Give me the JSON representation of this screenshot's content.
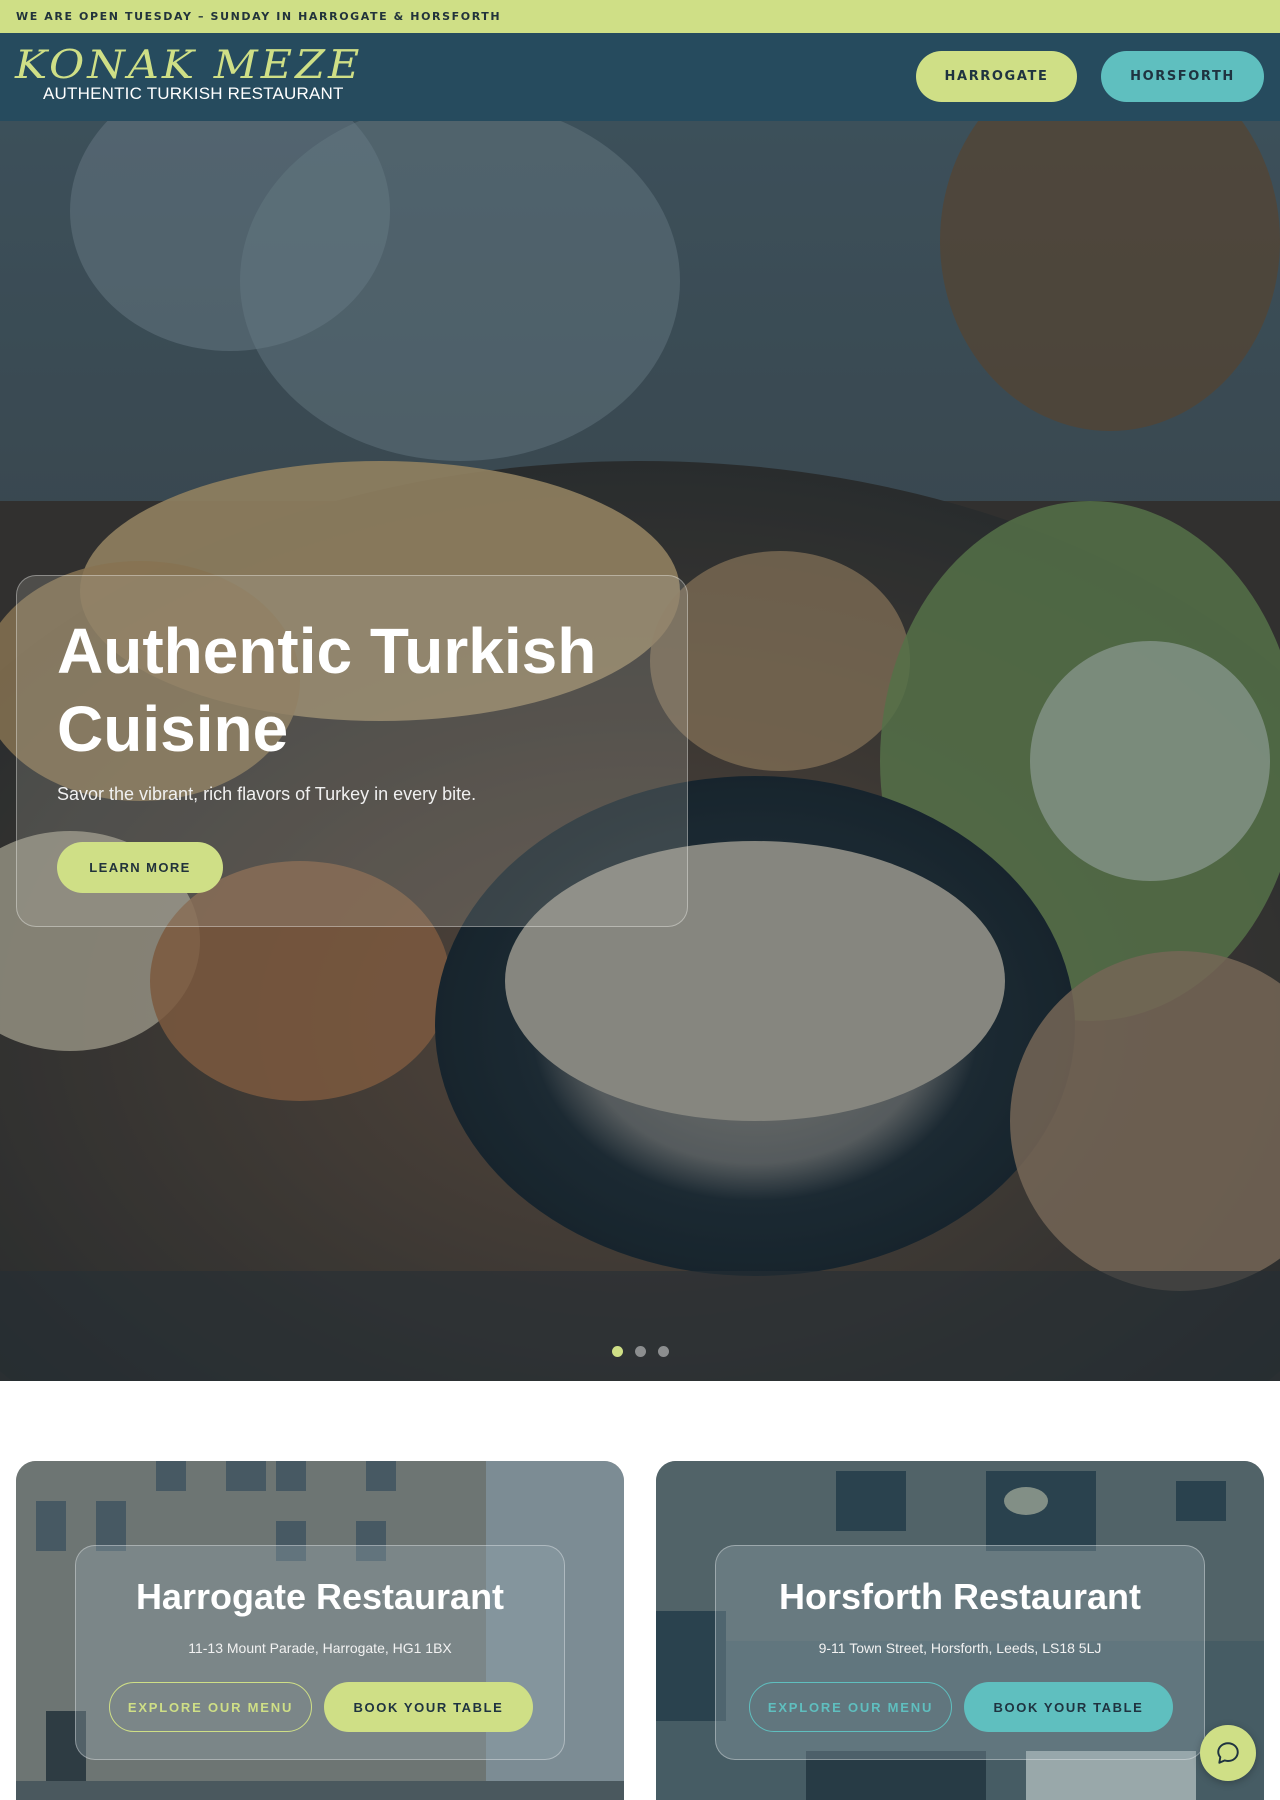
{
  "announcement": "WE ARE OPEN TUESDAY – SUNDAY IN HARROGATE & HORSFORTH",
  "logo": {
    "name": "KONAK MEZE",
    "tagline": "AUTHENTIC TURKISH RESTAURANT"
  },
  "nav": {
    "harrogate": "HARROGATE",
    "horsforth": "HORSFORTH"
  },
  "hero": {
    "title": "Authentic Turkish Cuisine",
    "subtitle": "Savor the vibrant, rich flavors of Turkey in every bite.",
    "cta": "LEARN MORE",
    "slides": 3,
    "active_slide": 1
  },
  "locations": [
    {
      "title": "Harrogate Restaurant",
      "address": "11-13 Mount Parade, Harrogate, HG1 1BX",
      "menu_label": "EXPLORE OUR MENU",
      "book_label": "BOOK YOUR TABLE"
    },
    {
      "title": "Horsforth Restaurant",
      "address": "9-11 Town Street, Horsforth, Leeds, LS18 5LJ",
      "menu_label": "EXPLORE OUR MENU",
      "book_label": "BOOK YOUR TABLE"
    }
  ],
  "colors": {
    "accent_lime": "#cfdf86",
    "accent_teal": "#5fbfbf",
    "header_bg": "#264b5e"
  },
  "icons": {
    "chat": "chat-bubble-icon"
  }
}
